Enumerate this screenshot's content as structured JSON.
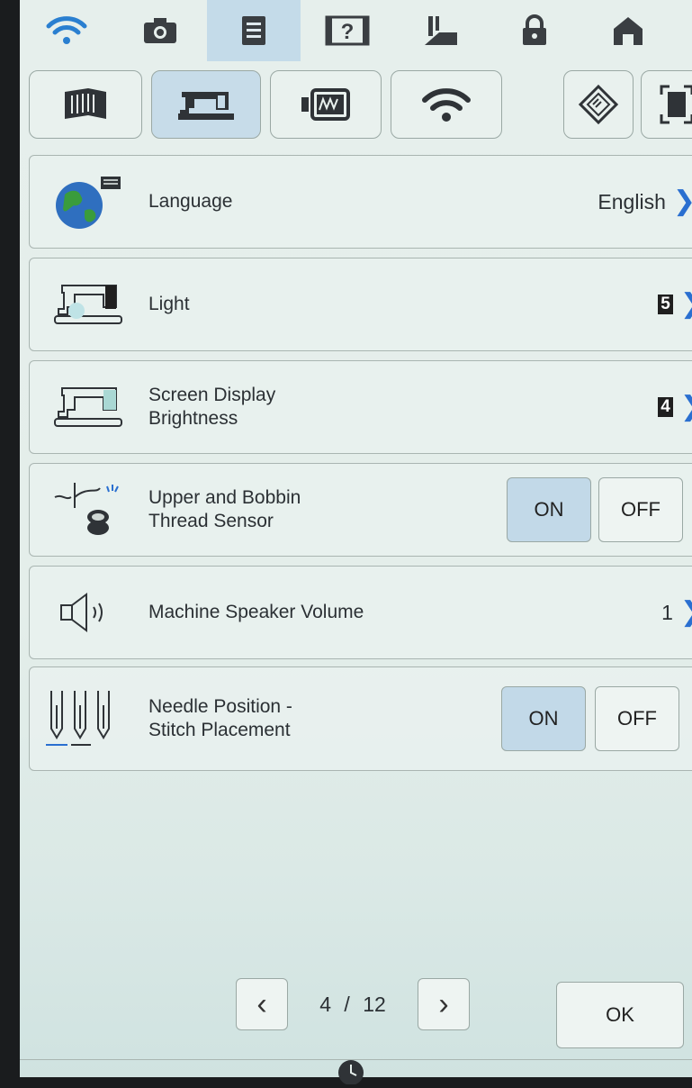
{
  "topbar": {
    "icons": [
      "wifi-icon",
      "camera-icon",
      "settings-page-icon",
      "help-icon",
      "presser-foot-icon",
      "lock-icon",
      "home-icon"
    ],
    "active_index": 2
  },
  "category_tabs": {
    "icons": [
      "stitch-settings-icon",
      "machine-settings-icon",
      "embroidery-settings-icon",
      "wifi-settings-icon",
      "camera-settings-icon",
      "frame-settings-icon"
    ],
    "active_index": 1
  },
  "settings": {
    "language": {
      "label": "Language",
      "value": "English"
    },
    "light": {
      "label": "Light",
      "value": "5"
    },
    "screen_brightness": {
      "label": "Screen Display\nBrightness",
      "value": "4"
    },
    "thread_sensor": {
      "label": "Upper and Bobbin\nThread Sensor",
      "on": "ON",
      "off": "OFF",
      "state": "ON"
    },
    "speaker_volume": {
      "label": "Machine Speaker Volume",
      "value": "1"
    },
    "needle_position": {
      "label": "Needle Position -\nStitch Placement",
      "on": "ON",
      "off": "OFF",
      "state": "ON"
    }
  },
  "pager": {
    "current": "4",
    "separator": "/",
    "total": "12"
  },
  "ok_button": {
    "label": "OK"
  },
  "colors": {
    "accent": "#2a6fd0",
    "active_fill": "#c4dbe9"
  }
}
